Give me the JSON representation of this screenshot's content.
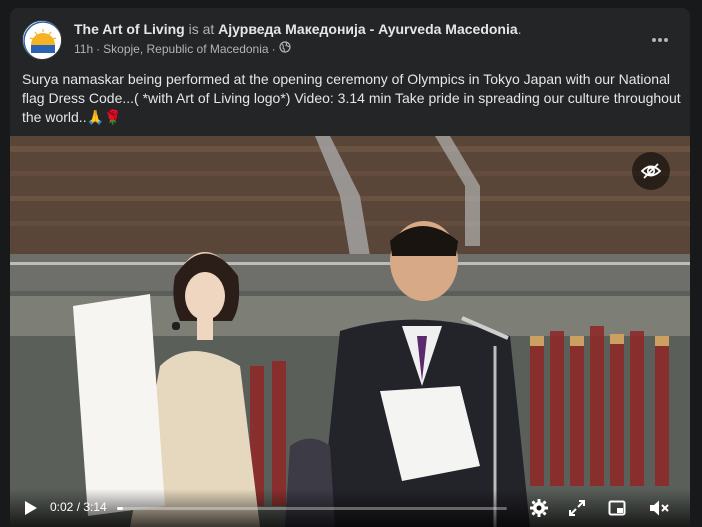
{
  "post": {
    "author": "The Art of Living",
    "verb": " is at ",
    "location": "Ајурведа Македонија - Ayurveda Macedonia",
    "trailing_period": ".",
    "time": "11h",
    "separator": "·",
    "place": "Skopje, Republic of Macedonia",
    "audience_separator": "·",
    "text": "Surya namaskar being performed  at the opening ceremony of Olympics in Tokyo Japan with our National flag Dress Code...( *with  Art of Living logo*) Video: 3.14 min   Take pride in spreading our culture throughout the world..🙏🌹"
  },
  "video": {
    "current_time": "0:02",
    "time_separator": " / ",
    "duration": "3:14",
    "progress_fraction": 0.0103
  },
  "icons": {
    "avatar": "art-of-living-logo",
    "audience": "globe-icon",
    "more": "more-horizontal-icon",
    "sensitive": "eye-slash-icon",
    "play": "play-icon",
    "settings": "gear-icon",
    "fullscreen": "expand-icon",
    "pip": "picture-in-picture-icon",
    "mute": "speaker-muted-icon"
  }
}
